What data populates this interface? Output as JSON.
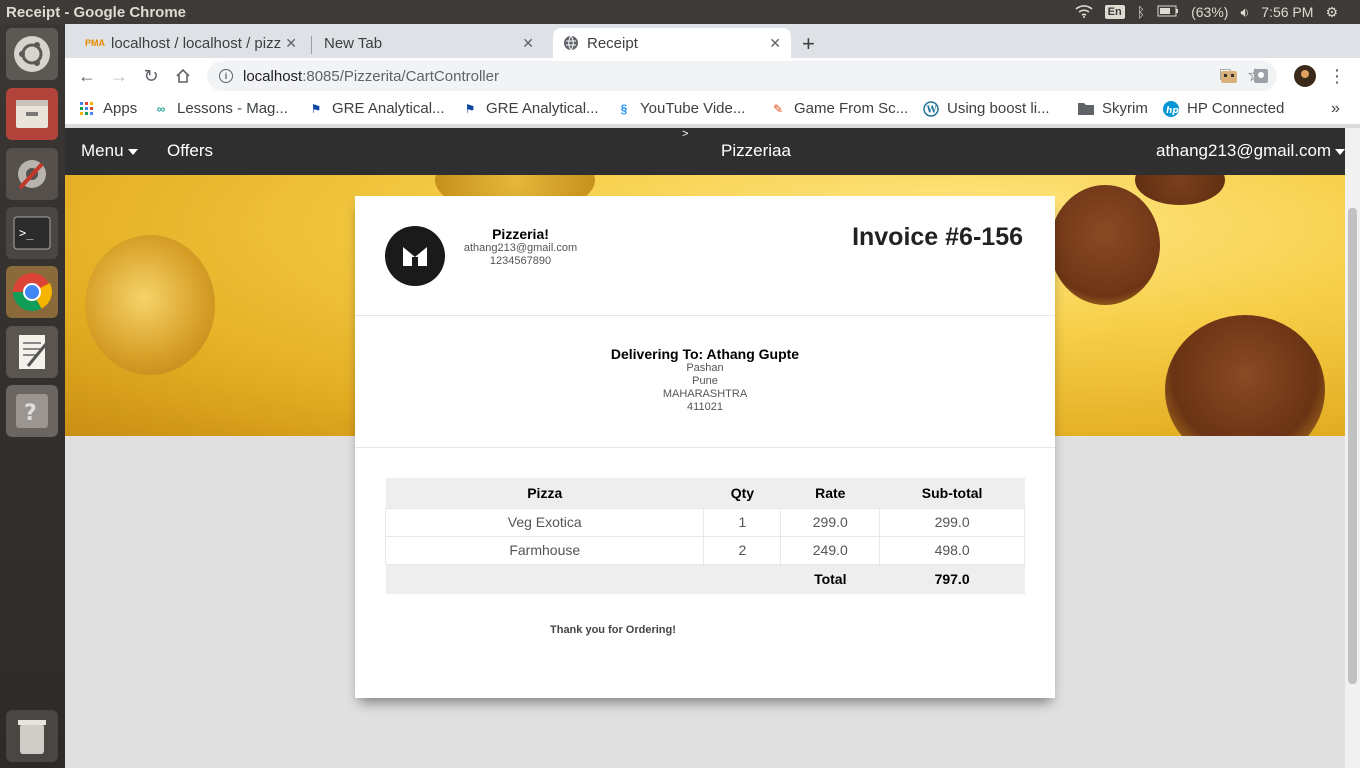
{
  "window": {
    "title": "Receipt - Google Chrome"
  },
  "tray": {
    "lang": "En",
    "battery": "(63%)",
    "time": "7:56 PM"
  },
  "tabs": [
    {
      "label": "localhost / localhost / pizz"
    },
    {
      "label": "New Tab"
    },
    {
      "label": "Receipt"
    }
  ],
  "omnibox": {
    "host": "localhost",
    "path": ":8085/Pizzerita/CartController"
  },
  "bookmarks": [
    {
      "label": "Apps"
    },
    {
      "label": "Lessons - Mag..."
    },
    {
      "label": "GRE Analytical..."
    },
    {
      "label": "GRE Analytical..."
    },
    {
      "label": "YouTube Vide..."
    },
    {
      "label": "Game From Sc..."
    },
    {
      "label": "Using boost li..."
    },
    {
      "label": "Skyrim"
    },
    {
      "label": "HP Connected"
    }
  ],
  "navbar": {
    "menu": "Menu",
    "offers": "Offers",
    "arrow": ">",
    "brand": "Pizzeriaa",
    "user": "athang213@gmail.com"
  },
  "receipt": {
    "company": "Pizzeria!",
    "email": "athang213@gmail.com",
    "phone": "1234567890",
    "invoice": "Invoice #6-156",
    "deliver_to": "Delivering To: Athang Gupte",
    "address": [
      "Pashan",
      "Pune",
      "MAHARASHTRA",
      "411021"
    ],
    "columns": [
      "Pizza",
      "Qty",
      "Rate",
      "Sub-total"
    ],
    "rows": [
      [
        "Veg Exotica",
        "1",
        "299.0",
        "299.0"
      ],
      [
        "Farmhouse",
        "2",
        "249.0",
        "498.0"
      ]
    ],
    "total_label": "Total",
    "total_value": "797.0",
    "thanks": "Thank you for Ordering!"
  }
}
